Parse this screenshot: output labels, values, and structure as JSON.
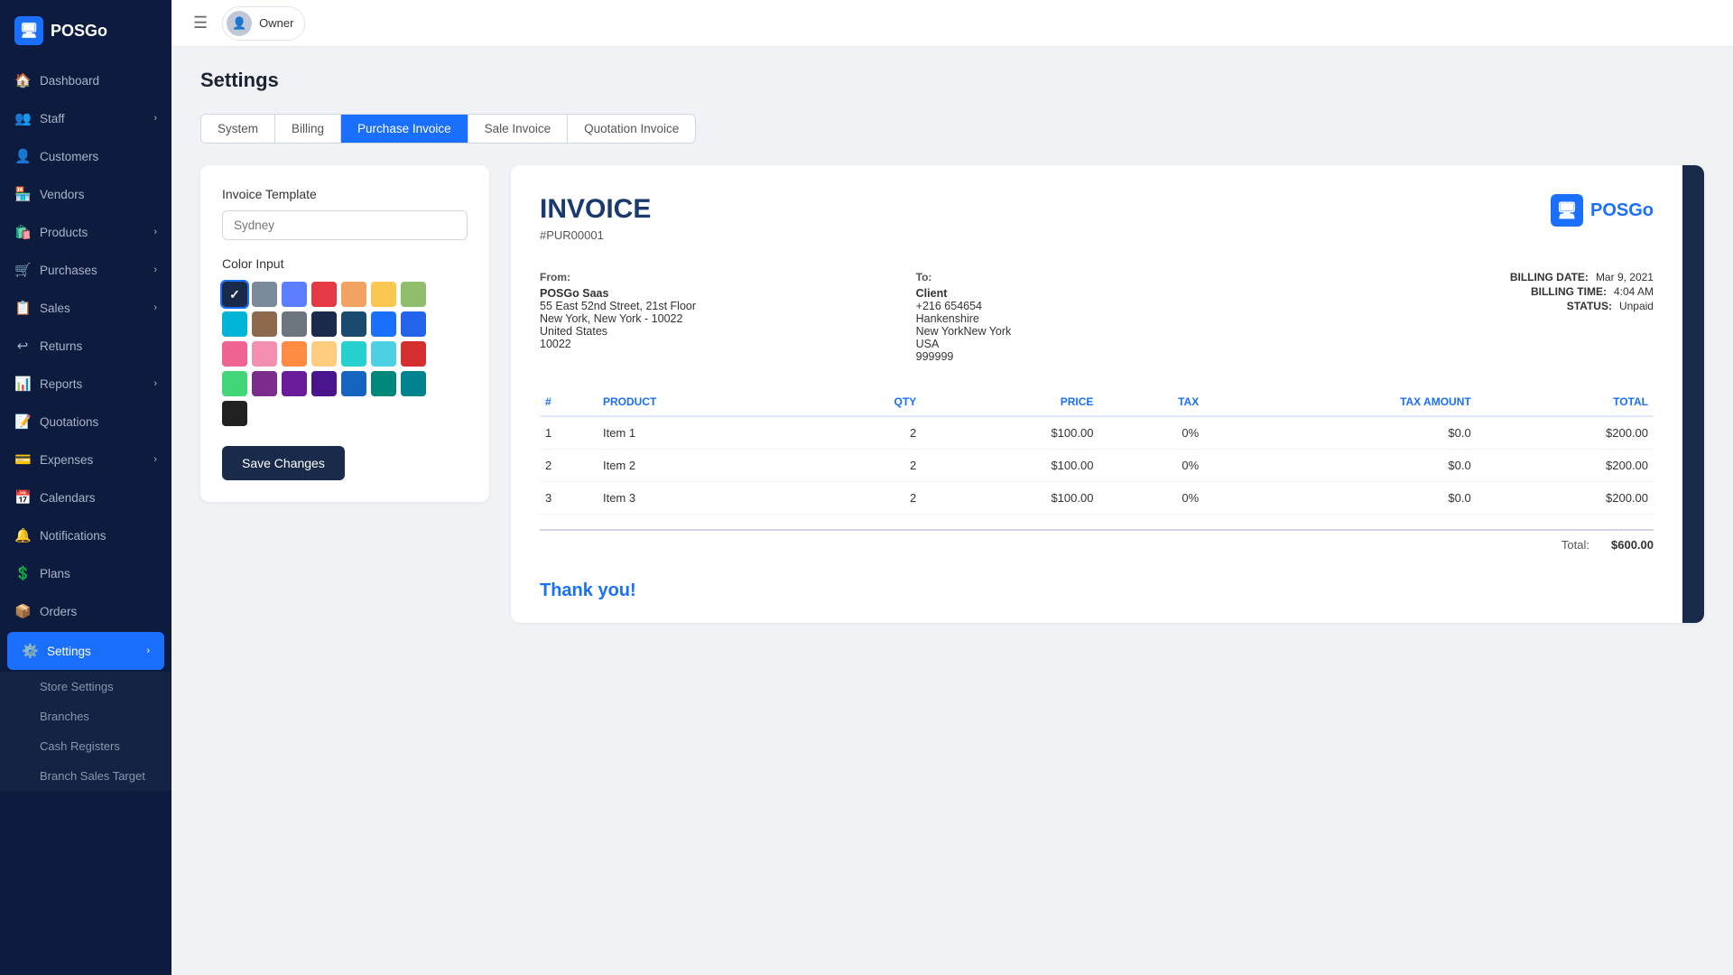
{
  "app": {
    "name": "POSGo"
  },
  "topbar": {
    "user_label": "Owner"
  },
  "sidebar": {
    "items": [
      {
        "id": "dashboard",
        "label": "Dashboard",
        "icon": "🏠",
        "has_children": false
      },
      {
        "id": "staff",
        "label": "Staff",
        "icon": "👥",
        "has_children": true
      },
      {
        "id": "customers",
        "label": "Customers",
        "icon": "👤",
        "has_children": false
      },
      {
        "id": "vendors",
        "label": "Vendors",
        "icon": "🏪",
        "has_children": false
      },
      {
        "id": "products",
        "label": "Products",
        "icon": "🛍️",
        "has_children": true
      },
      {
        "id": "purchases",
        "label": "Purchases",
        "icon": "🛒",
        "has_children": true
      },
      {
        "id": "sales",
        "label": "Sales",
        "icon": "📋",
        "has_children": true
      },
      {
        "id": "returns",
        "label": "Returns",
        "icon": "↩️",
        "has_children": false
      },
      {
        "id": "reports",
        "label": "Reports",
        "icon": "📊",
        "has_children": true
      },
      {
        "id": "quotations",
        "label": "Quotations",
        "icon": "📝",
        "has_children": false
      },
      {
        "id": "expenses",
        "label": "Expenses",
        "icon": "💳",
        "has_children": true
      },
      {
        "id": "calendars",
        "label": "Calendars",
        "icon": "📅",
        "has_children": false
      },
      {
        "id": "notifications",
        "label": "Notifications",
        "icon": "🔔",
        "has_children": false
      },
      {
        "id": "plans",
        "label": "Plans",
        "icon": "💲",
        "has_children": false
      },
      {
        "id": "orders",
        "label": "Orders",
        "icon": "📦",
        "has_children": false
      },
      {
        "id": "settings",
        "label": "Settings",
        "icon": "⚙️",
        "has_children": true,
        "active": true
      }
    ],
    "sub_items": [
      {
        "id": "store-settings",
        "label": "Store Settings"
      },
      {
        "id": "branches",
        "label": "Branches"
      },
      {
        "id": "cash-registers",
        "label": "Cash Registers"
      },
      {
        "id": "branch-sales-target",
        "label": "Branch Sales Target"
      }
    ]
  },
  "page": {
    "title": "Settings"
  },
  "tabs": [
    {
      "id": "system",
      "label": "System",
      "active": false
    },
    {
      "id": "billing",
      "label": "Billing",
      "active": false
    },
    {
      "id": "purchase-invoice",
      "label": "Purchase Invoice",
      "active": true
    },
    {
      "id": "sale-invoice",
      "label": "Sale Invoice",
      "active": false
    },
    {
      "id": "quotation-invoice",
      "label": "Quotation Invoice",
      "active": false
    }
  ],
  "form": {
    "template_label": "Invoice Template",
    "template_placeholder": "Sydney",
    "color_label": "Color Input",
    "save_button": "Save Changes"
  },
  "colors": [
    "#1a2a4a",
    "#7a8a9a",
    "#5b7eff",
    "#e63946",
    "#f4a261",
    "#f9c74f",
    "#90be6d",
    "#00b4d8",
    "#8d6a4e",
    "#6c757d",
    "#1a2a4a",
    "#1a4a6e",
    "#1a6fff",
    "#2563eb",
    "#f06292",
    "#f48fb1",
    "#ff8c42",
    "#ffcc80",
    "#26d0ce",
    "#4dd0e1",
    "#d32f2f",
    "#43d679",
    "#7b2d8b",
    "#6a1b9a",
    "#4a148c",
    "#1565c0",
    "#00897b",
    "#00838f",
    "#212121"
  ],
  "selected_color_index": 0,
  "invoice": {
    "title": "INVOICE",
    "number": "#PUR00001",
    "from_label": "From:",
    "from_name": "POSGo Saas",
    "from_address": "55 East 52nd Street, 21st Floor",
    "from_city": "New York, New York - 10022",
    "from_country": "United States",
    "from_zip": "10022",
    "to_label": "To:",
    "to_name": "Client",
    "to_phone": "+216 654654",
    "to_city1": "Hankenshire",
    "to_city2": "New YorkNew York",
    "to_country": "USA",
    "to_zip": "999999",
    "billing_date_label": "BILLING DATE:",
    "billing_date_val": "Mar 9, 2021",
    "billing_time_label": "BILLING TIME:",
    "billing_time_val": "4:04 AM",
    "status_label": "STATUS:",
    "status_val": "Unpaid",
    "table_headers": [
      "#",
      "PRODUCT",
      "QTY",
      "PRICE",
      "TAX",
      "TAX AMOUNT",
      "TOTAL"
    ],
    "table_rows": [
      {
        "num": "1",
        "product": "Item 1",
        "qty": "2",
        "price": "$100.00",
        "tax": "0%",
        "tax_amount": "$0.0",
        "total": "$200.00"
      },
      {
        "num": "2",
        "product": "Item 2",
        "qty": "2",
        "price": "$100.00",
        "tax": "0%",
        "tax_amount": "$0.0",
        "total": "$200.00"
      },
      {
        "num": "3",
        "product": "Item 3",
        "qty": "2",
        "price": "$100.00",
        "tax": "0%",
        "tax_amount": "$0.0",
        "total": "$200.00"
      }
    ],
    "total_label": "Total:",
    "total_val": "$600.00",
    "thank_you": "Thank you!"
  }
}
